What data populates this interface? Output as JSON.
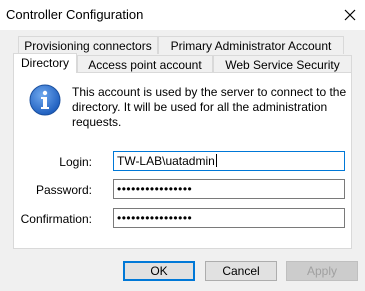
{
  "window": {
    "title": "Controller Configuration",
    "close_icon": "close-icon"
  },
  "tabs": {
    "row1": [
      {
        "label": "Provisioning connectors"
      },
      {
        "label": "Primary Administrator Account"
      }
    ],
    "row2": [
      {
        "label": "Directory",
        "active": true
      },
      {
        "label": "Access point account"
      },
      {
        "label": "Web Service Security"
      }
    ]
  },
  "info": {
    "icon": "info-icon",
    "text": "This account is used by the server to connect to the directory. It will be used for all the administration requests."
  },
  "form": {
    "login_label": "Login:",
    "login_value": "TW-LAB\\uatadmin",
    "password_label": "Password:",
    "password_value": "••••••••••••••••",
    "confirmation_label": "Confirmation:",
    "confirmation_value": "••••••••••••••••"
  },
  "buttons": {
    "ok": "OK",
    "cancel": "Cancel",
    "apply": "Apply"
  },
  "colors": {
    "accent": "#0078d7",
    "info_icon": "#1f5fbf"
  }
}
